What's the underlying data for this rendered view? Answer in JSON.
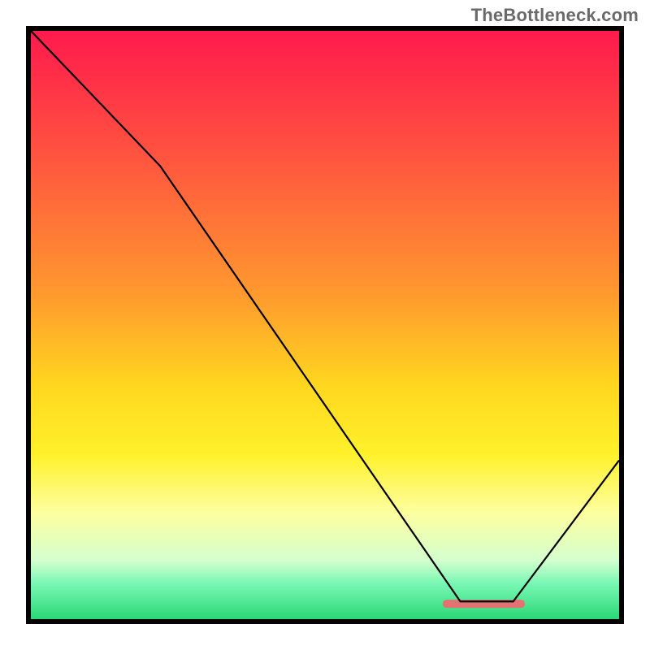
{
  "watermark": "TheBottleneck.com",
  "chart_data": {
    "type": "line",
    "title": "",
    "xlabel": "",
    "ylabel": "",
    "xlim": [
      0,
      100
    ],
    "ylim": [
      0,
      100
    ],
    "background_gradient_stops": [
      {
        "pct": 0.0,
        "color": "#ff1a4d"
      },
      {
        "pct": 20.0,
        "color": "#ff5040"
      },
      {
        "pct": 45.0,
        "color": "#ff9a2e"
      },
      {
        "pct": 60.0,
        "color": "#ffd61f"
      },
      {
        "pct": 72.0,
        "color": "#fff12a"
      },
      {
        "pct": 82.0,
        "color": "#fdffa0"
      },
      {
        "pct": 90.0,
        "color": "#d4ffce"
      },
      {
        "pct": 94.0,
        "color": "#78f7b4"
      },
      {
        "pct": 100.0,
        "color": "#2bd876"
      }
    ],
    "series": [
      {
        "name": "bottleneck-curve",
        "x": [
          0,
          22,
          73,
          82,
          100
        ],
        "y": [
          100,
          77,
          3,
          3,
          27
        ]
      }
    ],
    "annotations": [
      {
        "name": "bottom-bar",
        "type": "rect",
        "x0": 70,
        "x1": 84,
        "y": 2.6,
        "height": 1.4,
        "color": "#e57272"
      }
    ]
  }
}
